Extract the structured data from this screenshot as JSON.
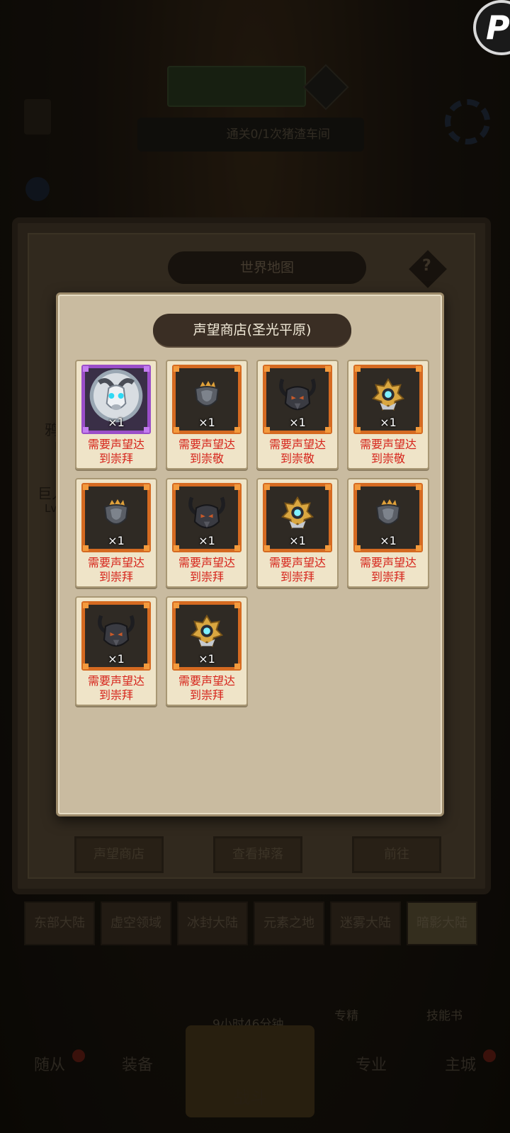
{
  "brand": {
    "letter": "P"
  },
  "background": {
    "top_banner": "",
    "quest_text": "通关0/1次猪渣车间",
    "left_label_top": "",
    "corner_label": ""
  },
  "world_map": {
    "title": "世界地图",
    "help": "?",
    "left_labels": [
      "鸦",
      "Lv",
      "巨人",
      "Lv."
    ],
    "buttons": [
      "声望商店",
      "查看掉落",
      "前往"
    ]
  },
  "region_tabs": [
    {
      "label": "东部大陆",
      "active": false
    },
    {
      "label": "虚空领域",
      "active": false
    },
    {
      "label": "冰封大陆",
      "active": false
    },
    {
      "label": "元素之地",
      "active": false
    },
    {
      "label": "迷雾大陆",
      "active": false
    },
    {
      "label": "暗影大陆",
      "active": true
    }
  ],
  "bottom_misc": {
    "timer": "9小时46分钟",
    "item1": "专精",
    "item2": "技能书"
  },
  "bottom_nav": {
    "companions": "随从",
    "equipment": "装备",
    "battle": "战斗",
    "profession": "专业",
    "main_city": "主城"
  },
  "shop": {
    "title": "声望商店(圣光平原)",
    "items": [
      {
        "icon": "goat-mount-icon",
        "rarity": "epic",
        "qty": "×1",
        "req_line1": "需要声望达",
        "req_line2": "到崇拜"
      },
      {
        "icon": "crown-shoulder-icon",
        "rarity": "legendary",
        "qty": "×1",
        "req_line1": "需要声望达",
        "req_line2": "到崇敬"
      },
      {
        "icon": "horned-helm-icon",
        "rarity": "legendary",
        "qty": "×1",
        "req_line1": "需要声望达",
        "req_line2": "到崇敬"
      },
      {
        "icon": "gold-emblem-icon",
        "rarity": "legendary",
        "qty": "×1",
        "req_line1": "需要声望达",
        "req_line2": "到崇敬"
      },
      {
        "icon": "crown-shoulder-icon",
        "rarity": "legendary",
        "qty": "×1",
        "req_line1": "需要声望达",
        "req_line2": "到崇拜"
      },
      {
        "icon": "horned-helm-icon",
        "rarity": "legendary",
        "qty": "×1",
        "req_line1": "需要声望达",
        "req_line2": "到崇拜"
      },
      {
        "icon": "gold-emblem-icon",
        "rarity": "legendary",
        "qty": "×1",
        "req_line1": "需要声望达",
        "req_line2": "到崇拜"
      },
      {
        "icon": "crown-shoulder-icon",
        "rarity": "legendary",
        "qty": "×1",
        "req_line1": "需要声望达",
        "req_line2": "到崇拜"
      },
      {
        "icon": "horned-helm-icon",
        "rarity": "legendary",
        "qty": "×1",
        "req_line1": "需要声望达",
        "req_line2": "到崇拜"
      },
      {
        "icon": "gold-emblem-icon",
        "rarity": "legendary",
        "qty": "×1",
        "req_line1": "需要声望达",
        "req_line2": "到崇拜"
      }
    ]
  },
  "colors": {
    "rarity_legendary": "#d56a21",
    "rarity_epic": "#9a4ec8",
    "requirement_text": "#d6231a"
  }
}
